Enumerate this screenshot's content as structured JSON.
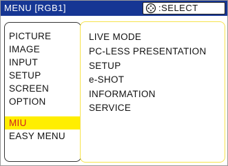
{
  "title": "MENU [RGB1]",
  "select_hint": ":SELECT",
  "select_icon": "joystick-cross-icon",
  "main_menu": [
    {
      "label": "PICTURE"
    },
    {
      "label": "IMAGE"
    },
    {
      "label": "INPUT"
    },
    {
      "label": "SETUP"
    },
    {
      "label": "SCREEN"
    },
    {
      "label": "OPTION"
    },
    {
      "label": "MIU"
    },
    {
      "label": "EASY MENU"
    }
  ],
  "selected_menu": "MIU",
  "sub_menu": [
    {
      "label": "LIVE MODE"
    },
    {
      "label": "PC-LESS PRESENTATION"
    },
    {
      "label": "SETUP"
    },
    {
      "label": "e-SHOT"
    },
    {
      "label": "INFORMATION"
    },
    {
      "label": "SERVICE"
    }
  ],
  "colors": {
    "title_bar": "#163694",
    "highlight": "#ffee00",
    "highlight_text": "#d21f1f",
    "submenu_border": "#f6e34a"
  }
}
